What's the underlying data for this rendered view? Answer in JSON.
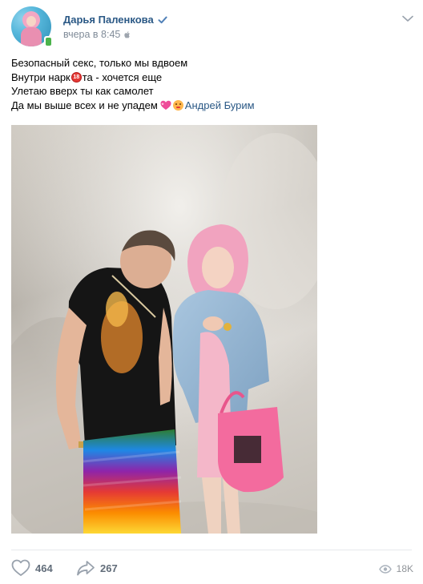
{
  "header": {
    "author_name": "Дарья Паленкова",
    "time": "вчера в 8:45",
    "verified_icon": "verified-check-icon",
    "platform_icon": "apple-icon",
    "menu_icon": "chevron-down-icon"
  },
  "post": {
    "lines": [
      {
        "text": "Безопасный секс, только мы вдвоем"
      },
      {
        "before": "Внутри нарк",
        "emoji": "18",
        "after": "та - хочется еще"
      },
      {
        "text": "Улетаю вверх ты как самолет"
      },
      {
        "text": "Да мы выше всех и не упадем",
        "mention": "Андрей Бурим"
      }
    ]
  },
  "footer": {
    "likes": "464",
    "shares": "267",
    "views": "18K",
    "like_icon": "heart-icon",
    "share_icon": "share-arrow-icon",
    "views_icon": "eye-icon"
  },
  "colors": {
    "link": "#2a5885",
    "secondary": "#818c99",
    "action": "#626d7a",
    "online": "#4bb34b",
    "verified": "#5181b8"
  }
}
